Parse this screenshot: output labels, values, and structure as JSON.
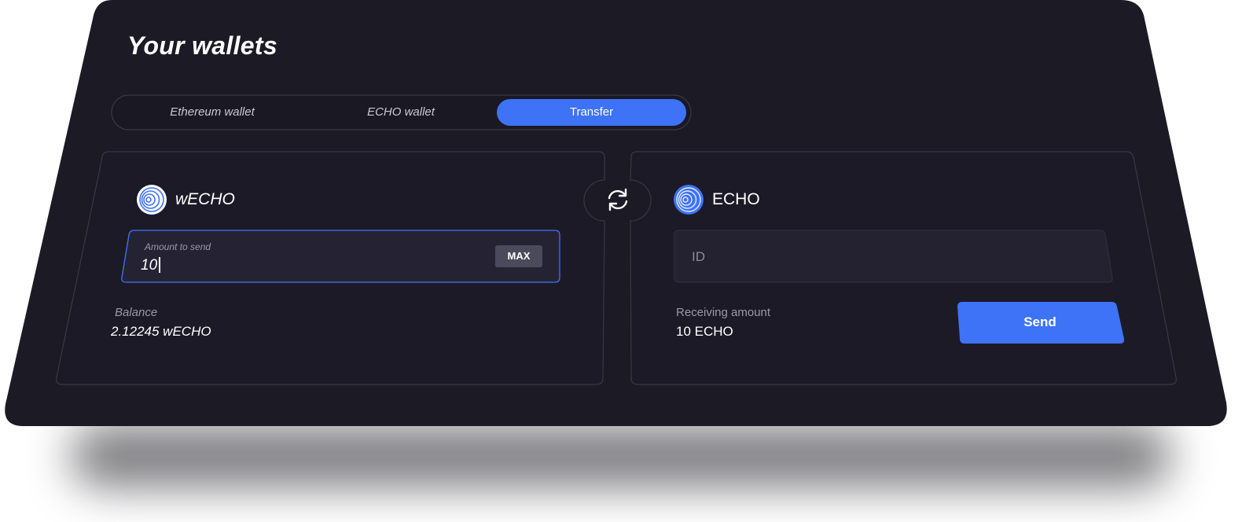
{
  "page": {
    "title": "Your wallets"
  },
  "tabs": [
    {
      "label": "Ethereum wallet",
      "active": false
    },
    {
      "label": "ECHO wallet",
      "active": false
    },
    {
      "label": "Transfer",
      "active": true
    }
  ],
  "left_panel": {
    "coin_name": "wECHO",
    "coin_icon": "echo-spiral-icon",
    "amount_field": {
      "label": "Amount to send",
      "value": "10"
    },
    "max_label": "MAX",
    "balance_label": "Balance",
    "balance_value": "2.12245 wECHO"
  },
  "swap_icon": "swap-arrows-icon",
  "right_panel": {
    "coin_name": "ECHO",
    "coin_icon": "echo-spiral-icon",
    "id_field": {
      "placeholder": "ID",
      "value": ""
    },
    "receiving_label": "Receiving amount",
    "receiving_value": "10 ECHO",
    "send_label": "Send"
  },
  "colors": {
    "background": "#1c1a25",
    "panel_border": "#3a3848",
    "accent": "#3e73f7",
    "input_fill": "#242230",
    "muted_text": "#9a99a8"
  }
}
